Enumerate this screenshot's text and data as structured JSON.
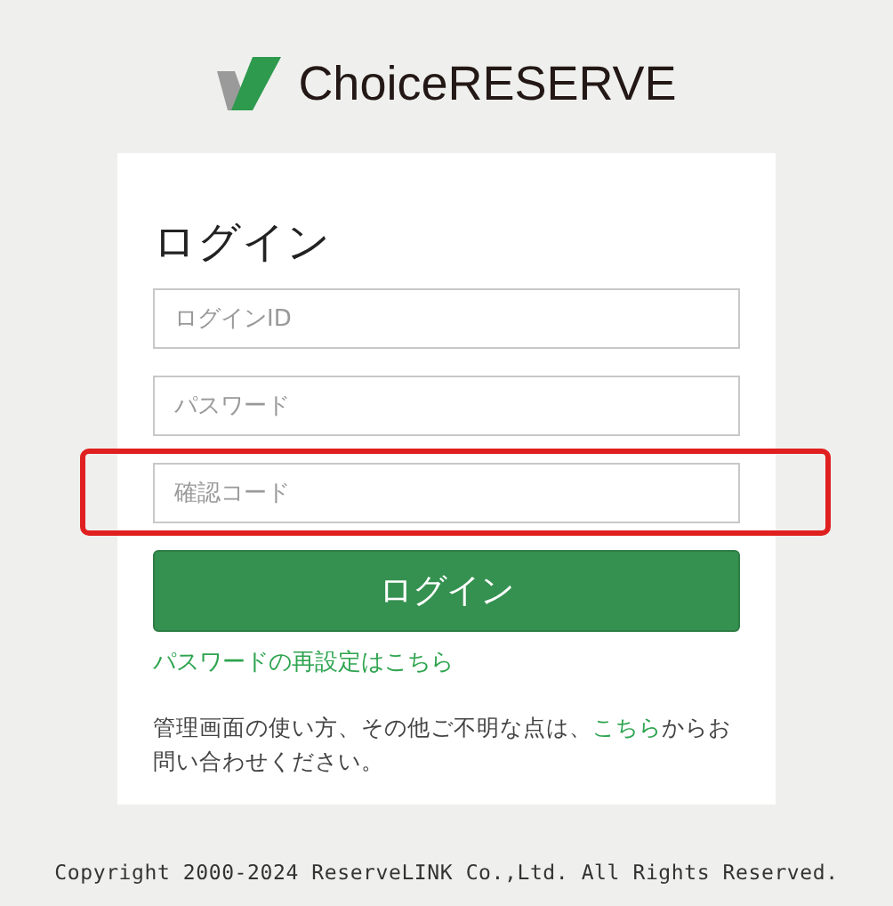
{
  "logo": {
    "text": "ChoiceRESERVE"
  },
  "login": {
    "title": "ログイン",
    "fields": [
      {
        "placeholder": "ログインID",
        "highlighted": false
      },
      {
        "placeholder": "パスワード",
        "highlighted": false
      },
      {
        "placeholder": "確認コード",
        "highlighted": true
      }
    ],
    "submit": "ログイン",
    "reset_link": "パスワードの再設定はこちら",
    "note": {
      "before": "管理画面の使い方、その他ご不明な点は、",
      "link": "こちら",
      "after": "からお問い合わせください。"
    }
  },
  "footer": "Copyright 2000-2024 ReserveLINK Co.,Ltd. All Rights Reserved."
}
